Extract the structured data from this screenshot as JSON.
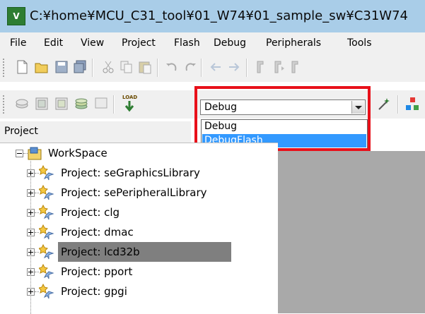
{
  "titlebar": {
    "title": "C:¥home¥MCU_C31_tool¥01_W74¥01_sample_sw¥C31W74",
    "app_icon_glyph": "V"
  },
  "menu": [
    "File",
    "Edit",
    "View",
    "Project",
    "Flash",
    "Debug",
    "Peripherals",
    "Tools"
  ],
  "toolbar2": {
    "load_label": "LOAD"
  },
  "config_combo": {
    "selected": "Debug",
    "options": [
      "Debug",
      "DebugFlash"
    ],
    "hover_option": "DebugFlash"
  },
  "panel": {
    "title": "Project"
  },
  "tree": {
    "root": "WorkSpace",
    "items": [
      "Project: seGraphicsLibrary",
      "Project: sePeripheralLibrary",
      "Project: clg",
      "Project: dmac",
      "Project: lcd32b",
      "Project: pport",
      "Project: gpgi"
    ],
    "selected_index": 4
  },
  "colors": {
    "title_bg": "#a9cde8",
    "highlight": "#e8101a",
    "selection": "#3399ff"
  }
}
